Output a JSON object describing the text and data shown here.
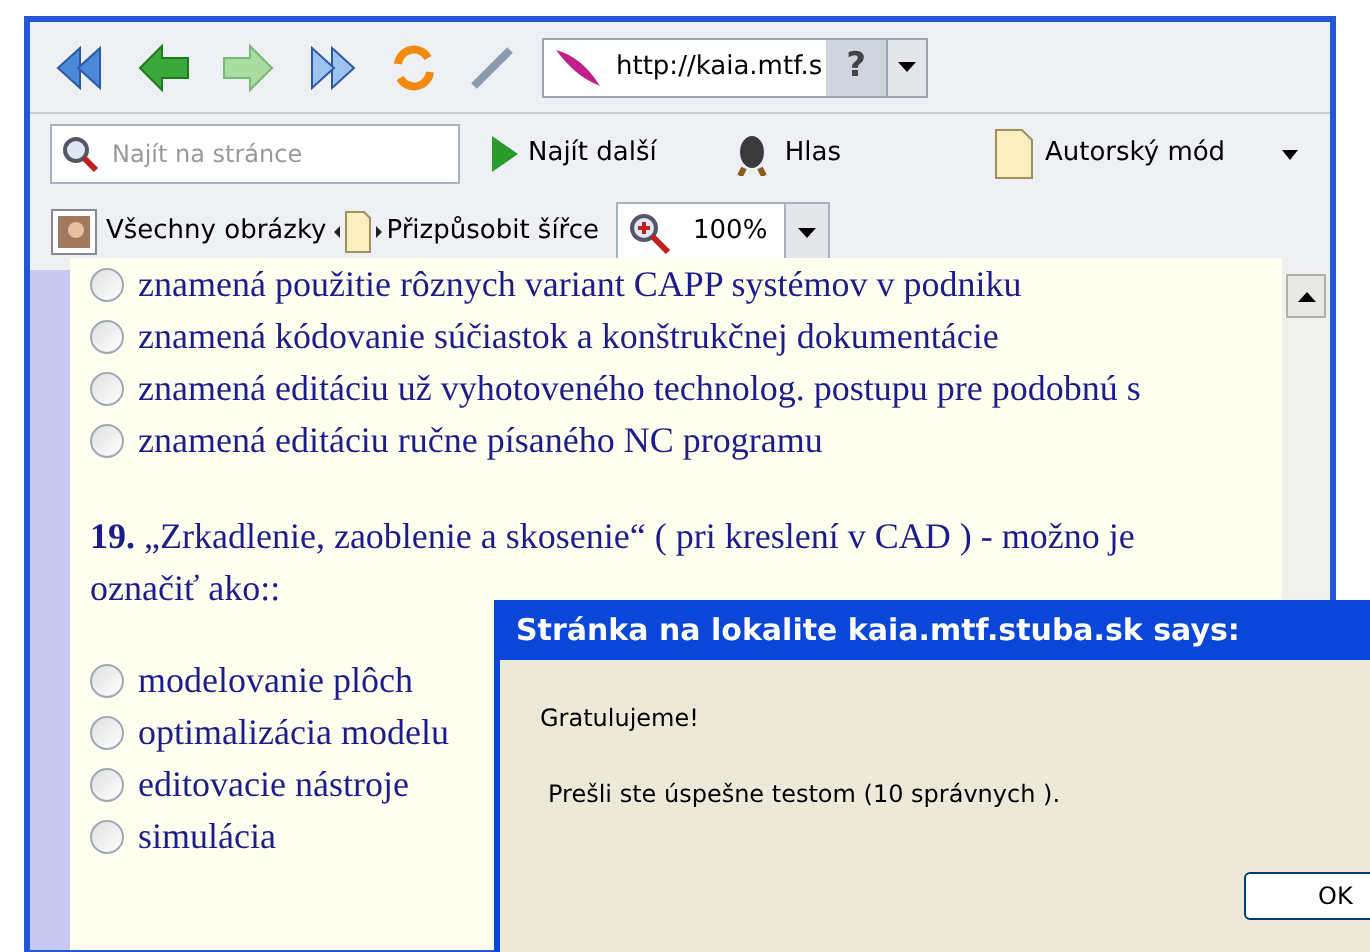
{
  "toolbar": {
    "url": "http://kaia.mtf.s",
    "help": "?"
  },
  "find_bar": {
    "placeholder": "Najít na stránce",
    "find_next": "Najít další",
    "voice": "Hlas",
    "author_mode": "Autorský mód"
  },
  "view_bar": {
    "all_images": "Všechny obrázky",
    "fit_width": "Přizpůsobit šířce",
    "zoom": "100%"
  },
  "question_18_options": [
    {
      "label": "znamená použitie rôznych variant CAPP systémov v podniku",
      "selected": false
    },
    {
      "label": "znamená kódovanie súčiastok a konštrukčnej dokumentácie",
      "selected": false
    },
    {
      "label": "znamená editáciu už vyhotoveného technolog. postupu pre podobnú s",
      "selected": false
    },
    {
      "label": "znamená editáciu ručne písaného NC programu",
      "selected": false
    }
  ],
  "question_19": {
    "number": "19.",
    "text_line_1": "„Zrkadlenie, zaoblenie a skosenie“ ( pri kreslení v CAD ) - možno je",
    "text_line_2": "označiť ako::",
    "options": [
      {
        "label": "modelovanie plôch",
        "selected": false
      },
      {
        "label": "optimalizácia modelu",
        "selected": false
      },
      {
        "label": "editovacie nástroje",
        "selected": false
      },
      {
        "label": "simulácia",
        "selected": false
      }
    ]
  },
  "dialog": {
    "title": "Stránka na lokalite kaia.mtf.stuba.sk says:",
    "heading": "Gratulujeme!",
    "message": "Prešli ste úspešne testom (10 správnych ).",
    "ok": "OK"
  }
}
